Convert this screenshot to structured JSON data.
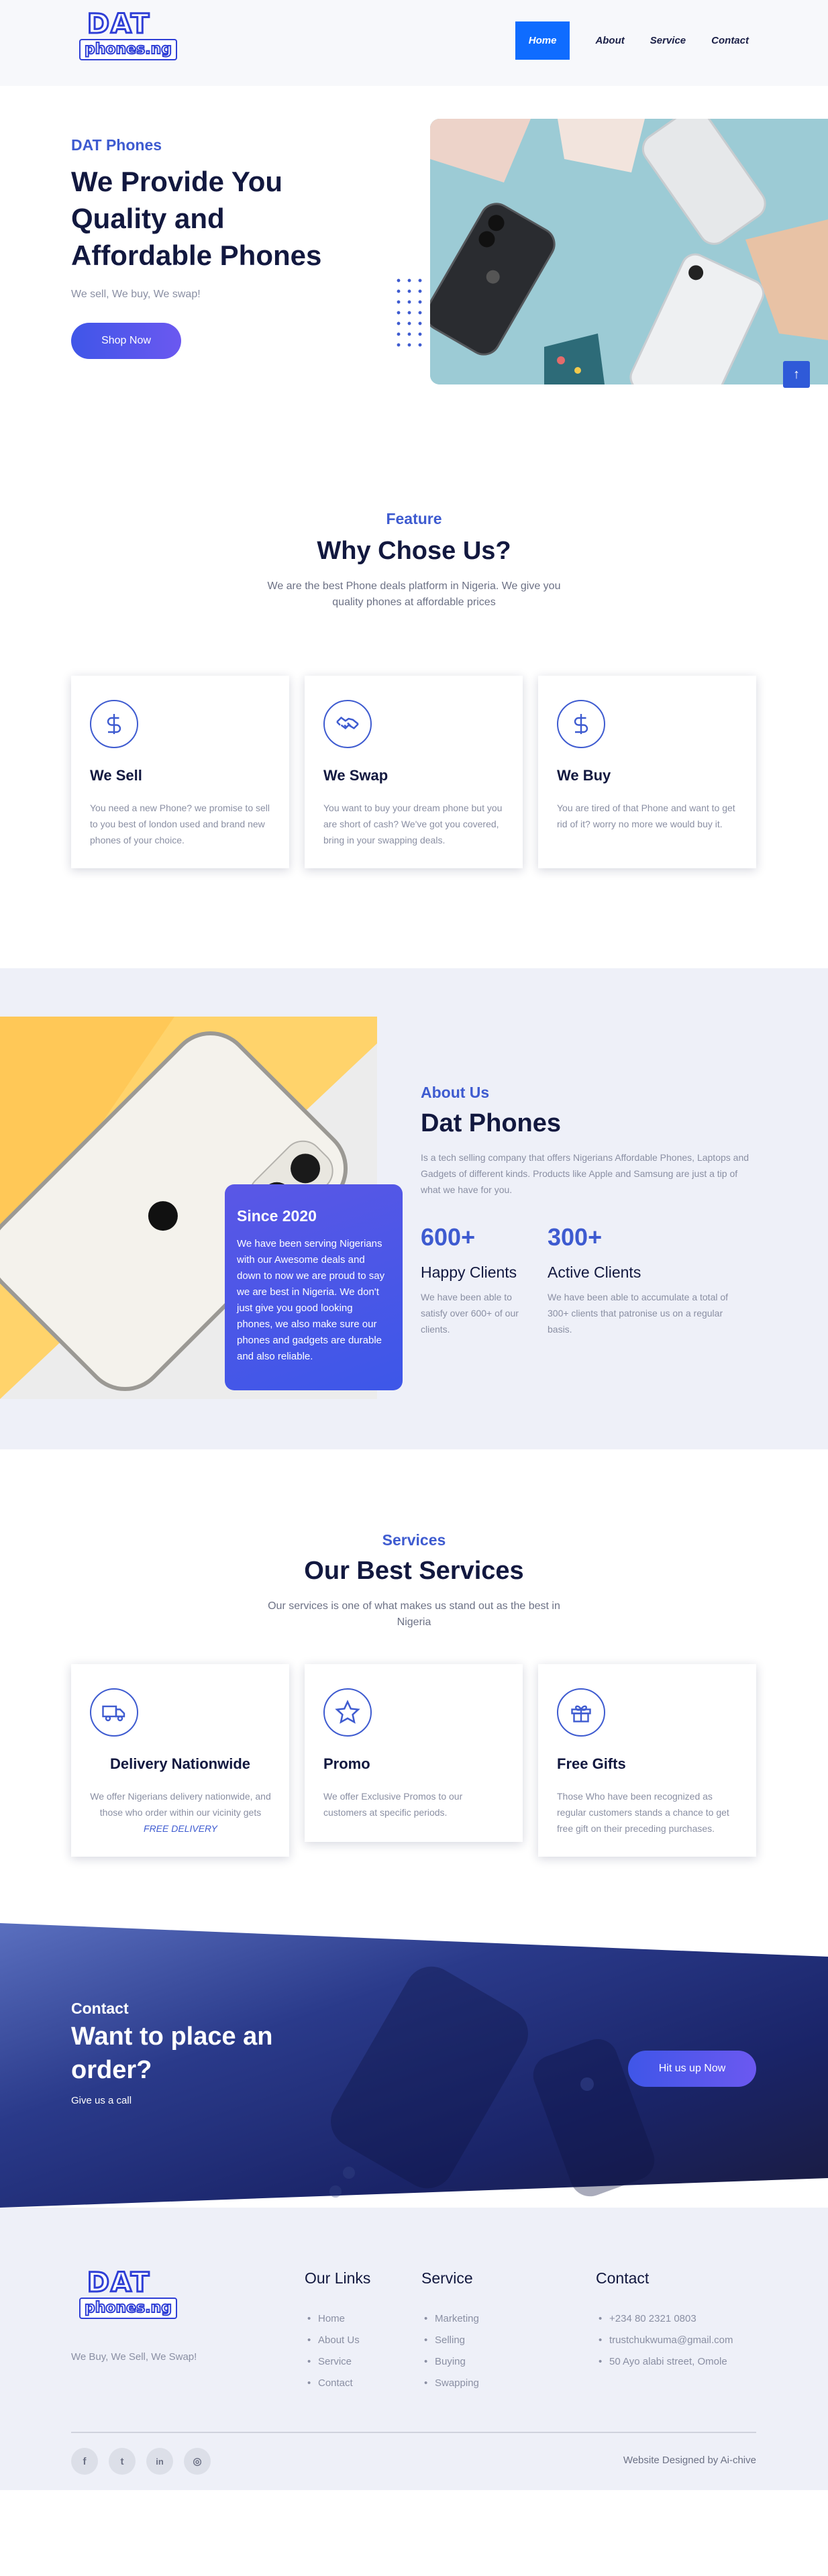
{
  "brand": {
    "logo_top": "DAT",
    "logo_bottom": "phones.ng"
  },
  "nav": {
    "items": [
      {
        "label": "Home",
        "active": true
      },
      {
        "label": "About",
        "active": false
      },
      {
        "label": "Service",
        "active": false
      },
      {
        "label": "Contact",
        "active": false
      }
    ]
  },
  "hero": {
    "kicker": "DAT Phones",
    "title": "We Provide You Quality and Affordable Phones",
    "subtitle": "We sell, We buy, We swap!",
    "button": "Shop Now",
    "scroll_top_icon": "arrow-up-icon"
  },
  "features": {
    "kicker": "Feature",
    "title": "Why Chose Us?",
    "description": "We are the best Phone deals platform in Nigeria. We give you quality phones at affordable prices",
    "cards": [
      {
        "icon": "dollar-icon",
        "title": "We Sell",
        "text": "You need a new Phone? we promise to sell to you best of london used and brand new phones of your choice."
      },
      {
        "icon": "handshake-icon",
        "title": "We Swap",
        "text": "You want to buy your dream phone but you are short of cash? We've got you covered, bring in your swapping deals."
      },
      {
        "icon": "dollar-icon",
        "title": "We Buy",
        "text": "You are tired of that Phone and want to get rid of it? worry no more we would buy it."
      }
    ]
  },
  "about": {
    "since_title": "Since 2020",
    "since_text": "We have been serving Nigerians with our Awesome deals and down to now we are proud to say we are best in Nigeria. We don't just give you good looking phones, we also make sure our phones and gadgets are durable and also reliable.",
    "kicker": "About Us",
    "title": "Dat Phones",
    "description": "Is a tech selling company that offers Nigerians Affordable Phones, Laptops and Gadgets of different kinds. Products like Apple and Samsung are just a tip of what we have for you.",
    "stats": [
      {
        "value": "600+",
        "label": "Happy Clients",
        "text": "We have been able to satisfy over 600+ of our clients."
      },
      {
        "value": "300+",
        "label": "Active Clients",
        "text": "We have been able to accumulate a total of 300+ clients that patronise us on a regular basis."
      }
    ]
  },
  "services": {
    "kicker": "Services",
    "title": "Our Best Services",
    "description": "Our services is one of what makes us stand out as the best in Nigeria",
    "cards": [
      {
        "icon": "truck-icon",
        "title": "Delivery Nationwide",
        "text": "We offer Nigerians delivery nationwide, and those who order within our vicinity gets",
        "highlight": "FREE DELIVERY"
      },
      {
        "icon": "star-icon",
        "title": "Promo",
        "text": "We offer Exclusive Promos to our customers at specific periods."
      },
      {
        "icon": "gift-icon",
        "title": "Free Gifts",
        "text": "Those Who have been recognized as regular customers stands a chance to get free gift on their preceding purchases."
      }
    ]
  },
  "contact": {
    "kicker": "Contact",
    "title": "Want to place an order?",
    "subtitle": "Give us a call",
    "button": "Hit us up Now"
  },
  "footer": {
    "tagline": "We Buy, We Sell, We Swap!",
    "links_title": "Our Links",
    "links": [
      "Home",
      "About Us",
      "Service",
      "Contact"
    ],
    "service_title": "Service",
    "service_items": [
      "Marketing",
      "Selling",
      "Buying",
      "Swapping"
    ],
    "contact_title": "Contact",
    "contact_items": [
      "+234 80 2321 0803",
      "trustchukwuma@gmail.com",
      "50 Ayo alabi street, Omole"
    ],
    "social": [
      {
        "icon": "facebook-icon",
        "glyph": "f"
      },
      {
        "icon": "twitter-icon",
        "glyph": "t"
      },
      {
        "icon": "linkedin-icon",
        "glyph": "in"
      },
      {
        "icon": "instagram-icon",
        "glyph": "◎"
      }
    ],
    "credit": "Website Designed by Ai-chive"
  },
  "colors": {
    "accent": "#3e5bd0",
    "nav_active": "#0f6cff",
    "dark_text": "#12183f",
    "muted": "#8a8fa3",
    "section_bg": "#eef0f8"
  }
}
